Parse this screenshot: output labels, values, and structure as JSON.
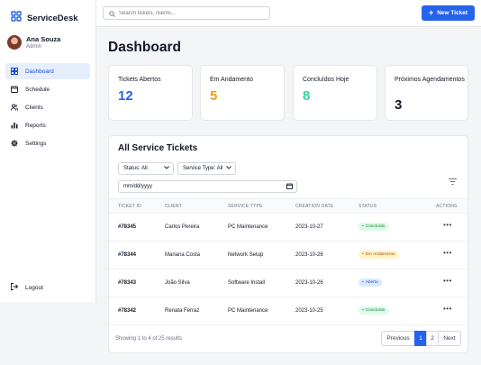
{
  "app": {
    "name": "ServiceDesk"
  },
  "user": {
    "name": "Ana Souza",
    "role": "Admin"
  },
  "nav": {
    "items": [
      {
        "label": "Dashboard",
        "icon": "grid-icon",
        "active": true
      },
      {
        "label": "Schedule",
        "icon": "calendar-icon"
      },
      {
        "label": "Clients",
        "icon": "users-icon"
      },
      {
        "label": "Reports",
        "icon": "bar-chart-icon"
      },
      {
        "label": "Settings",
        "icon": "gear-icon"
      }
    ],
    "logout": "Logout"
  },
  "search": {
    "placeholder": "Search tickets, clients..."
  },
  "new_ticket": {
    "label": "New Ticket"
  },
  "page_title": "Dashboard",
  "cards": [
    {
      "label": "Tickets Abertos",
      "value": "12",
      "color": "#2563eb"
    },
    {
      "label": "Em Andamento",
      "value": "5",
      "color": "#f59e0b"
    },
    {
      "label": "Concluídos Hoje",
      "value": "8",
      "color": "#34d399"
    },
    {
      "label": "Próximos Agendamentos",
      "value": "3",
      "color": "#111827"
    }
  ],
  "tickets": {
    "title": "All Service Tickets",
    "filters": {
      "status": "Status: All",
      "service_type": "Service Type: All",
      "date_placeholder": "mm/dd/yyyy"
    },
    "columns": [
      "Ticket ID",
      "Client",
      "Service Type",
      "Creation Date",
      "Status",
      "Actions"
    ],
    "rows": [
      {
        "id": "#78345",
        "client": "Carlos Pereira",
        "service": "PC Maintenance",
        "date": "2023-10-27",
        "status": "Concluído",
        "status_color": "green"
      },
      {
        "id": "#78344",
        "client": "Mariana Costa",
        "service": "Network Setup",
        "date": "2023-10-26",
        "status": "Em Andamento",
        "status_color": "amber"
      },
      {
        "id": "#78343",
        "client": "João Silva",
        "service": "Software Install",
        "date": "2023-10-26",
        "status": "Aberto",
        "status_color": "blue"
      },
      {
        "id": "#78342",
        "client": "Renata Ferraz",
        "service": "PC Maintenance",
        "date": "2023-10-25",
        "status": "Concluído",
        "status_color": "green"
      }
    ],
    "actions_label": "•••",
    "footer": "Showing 1 to 4 of 25 results",
    "pagination": {
      "previous": "Previous",
      "pages": [
        "1",
        "2"
      ],
      "current": "1",
      "next": "Next"
    }
  }
}
